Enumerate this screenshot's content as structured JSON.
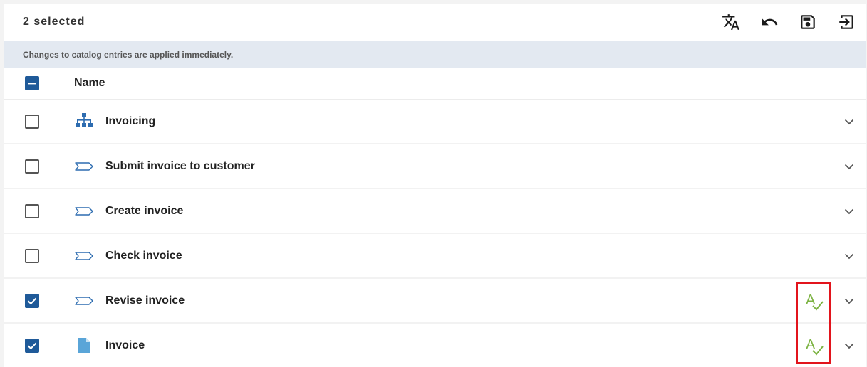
{
  "toolbar": {
    "selected_text": "2 selected",
    "actions": [
      {
        "name": "translate-icon"
      },
      {
        "name": "undo-icon"
      },
      {
        "name": "save-icon"
      },
      {
        "name": "exit-icon"
      }
    ]
  },
  "banner": {
    "message": "Changes to catalog entries are applied immediately."
  },
  "table": {
    "header_name": "Name",
    "rows": [
      {
        "label": "Invoicing",
        "icon": "org-chart-icon",
        "checked": false,
        "spellcheck": false
      },
      {
        "label": "Submit invoice to customer",
        "icon": "process-step-icon",
        "checked": false,
        "spellcheck": false
      },
      {
        "label": "Create invoice",
        "icon": "process-step-icon",
        "checked": false,
        "spellcheck": false
      },
      {
        "label": "Check invoice",
        "icon": "process-step-icon",
        "checked": false,
        "spellcheck": false
      },
      {
        "label": "Revise invoice",
        "icon": "process-step-icon",
        "checked": true,
        "spellcheck": true
      },
      {
        "label": "Invoice",
        "icon": "document-icon",
        "checked": true,
        "spellcheck": true
      }
    ]
  },
  "colors": {
    "accent": "#1f5a99",
    "icon_blue": "#2d6cb0",
    "doc_blue": "#5aa5d8",
    "spell_green": "#7cb342",
    "highlight_red": "#e2141c",
    "banner_bg": "#e3e9f1"
  }
}
